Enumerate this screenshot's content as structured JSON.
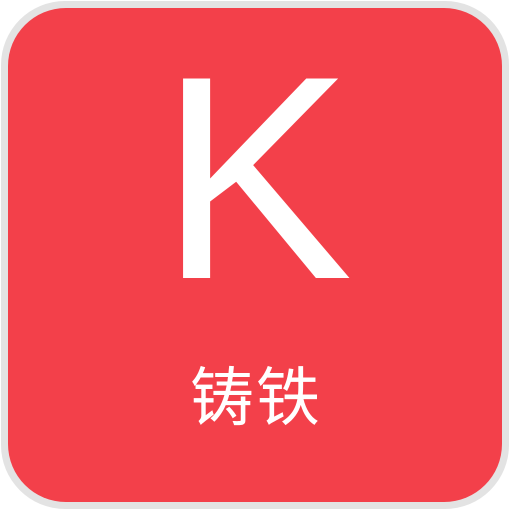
{
  "icon": {
    "letter": "K",
    "label": "铸铁",
    "background_color": "#f3404a",
    "border_color": "#e3e3e3",
    "text_color": "#ffffff"
  }
}
